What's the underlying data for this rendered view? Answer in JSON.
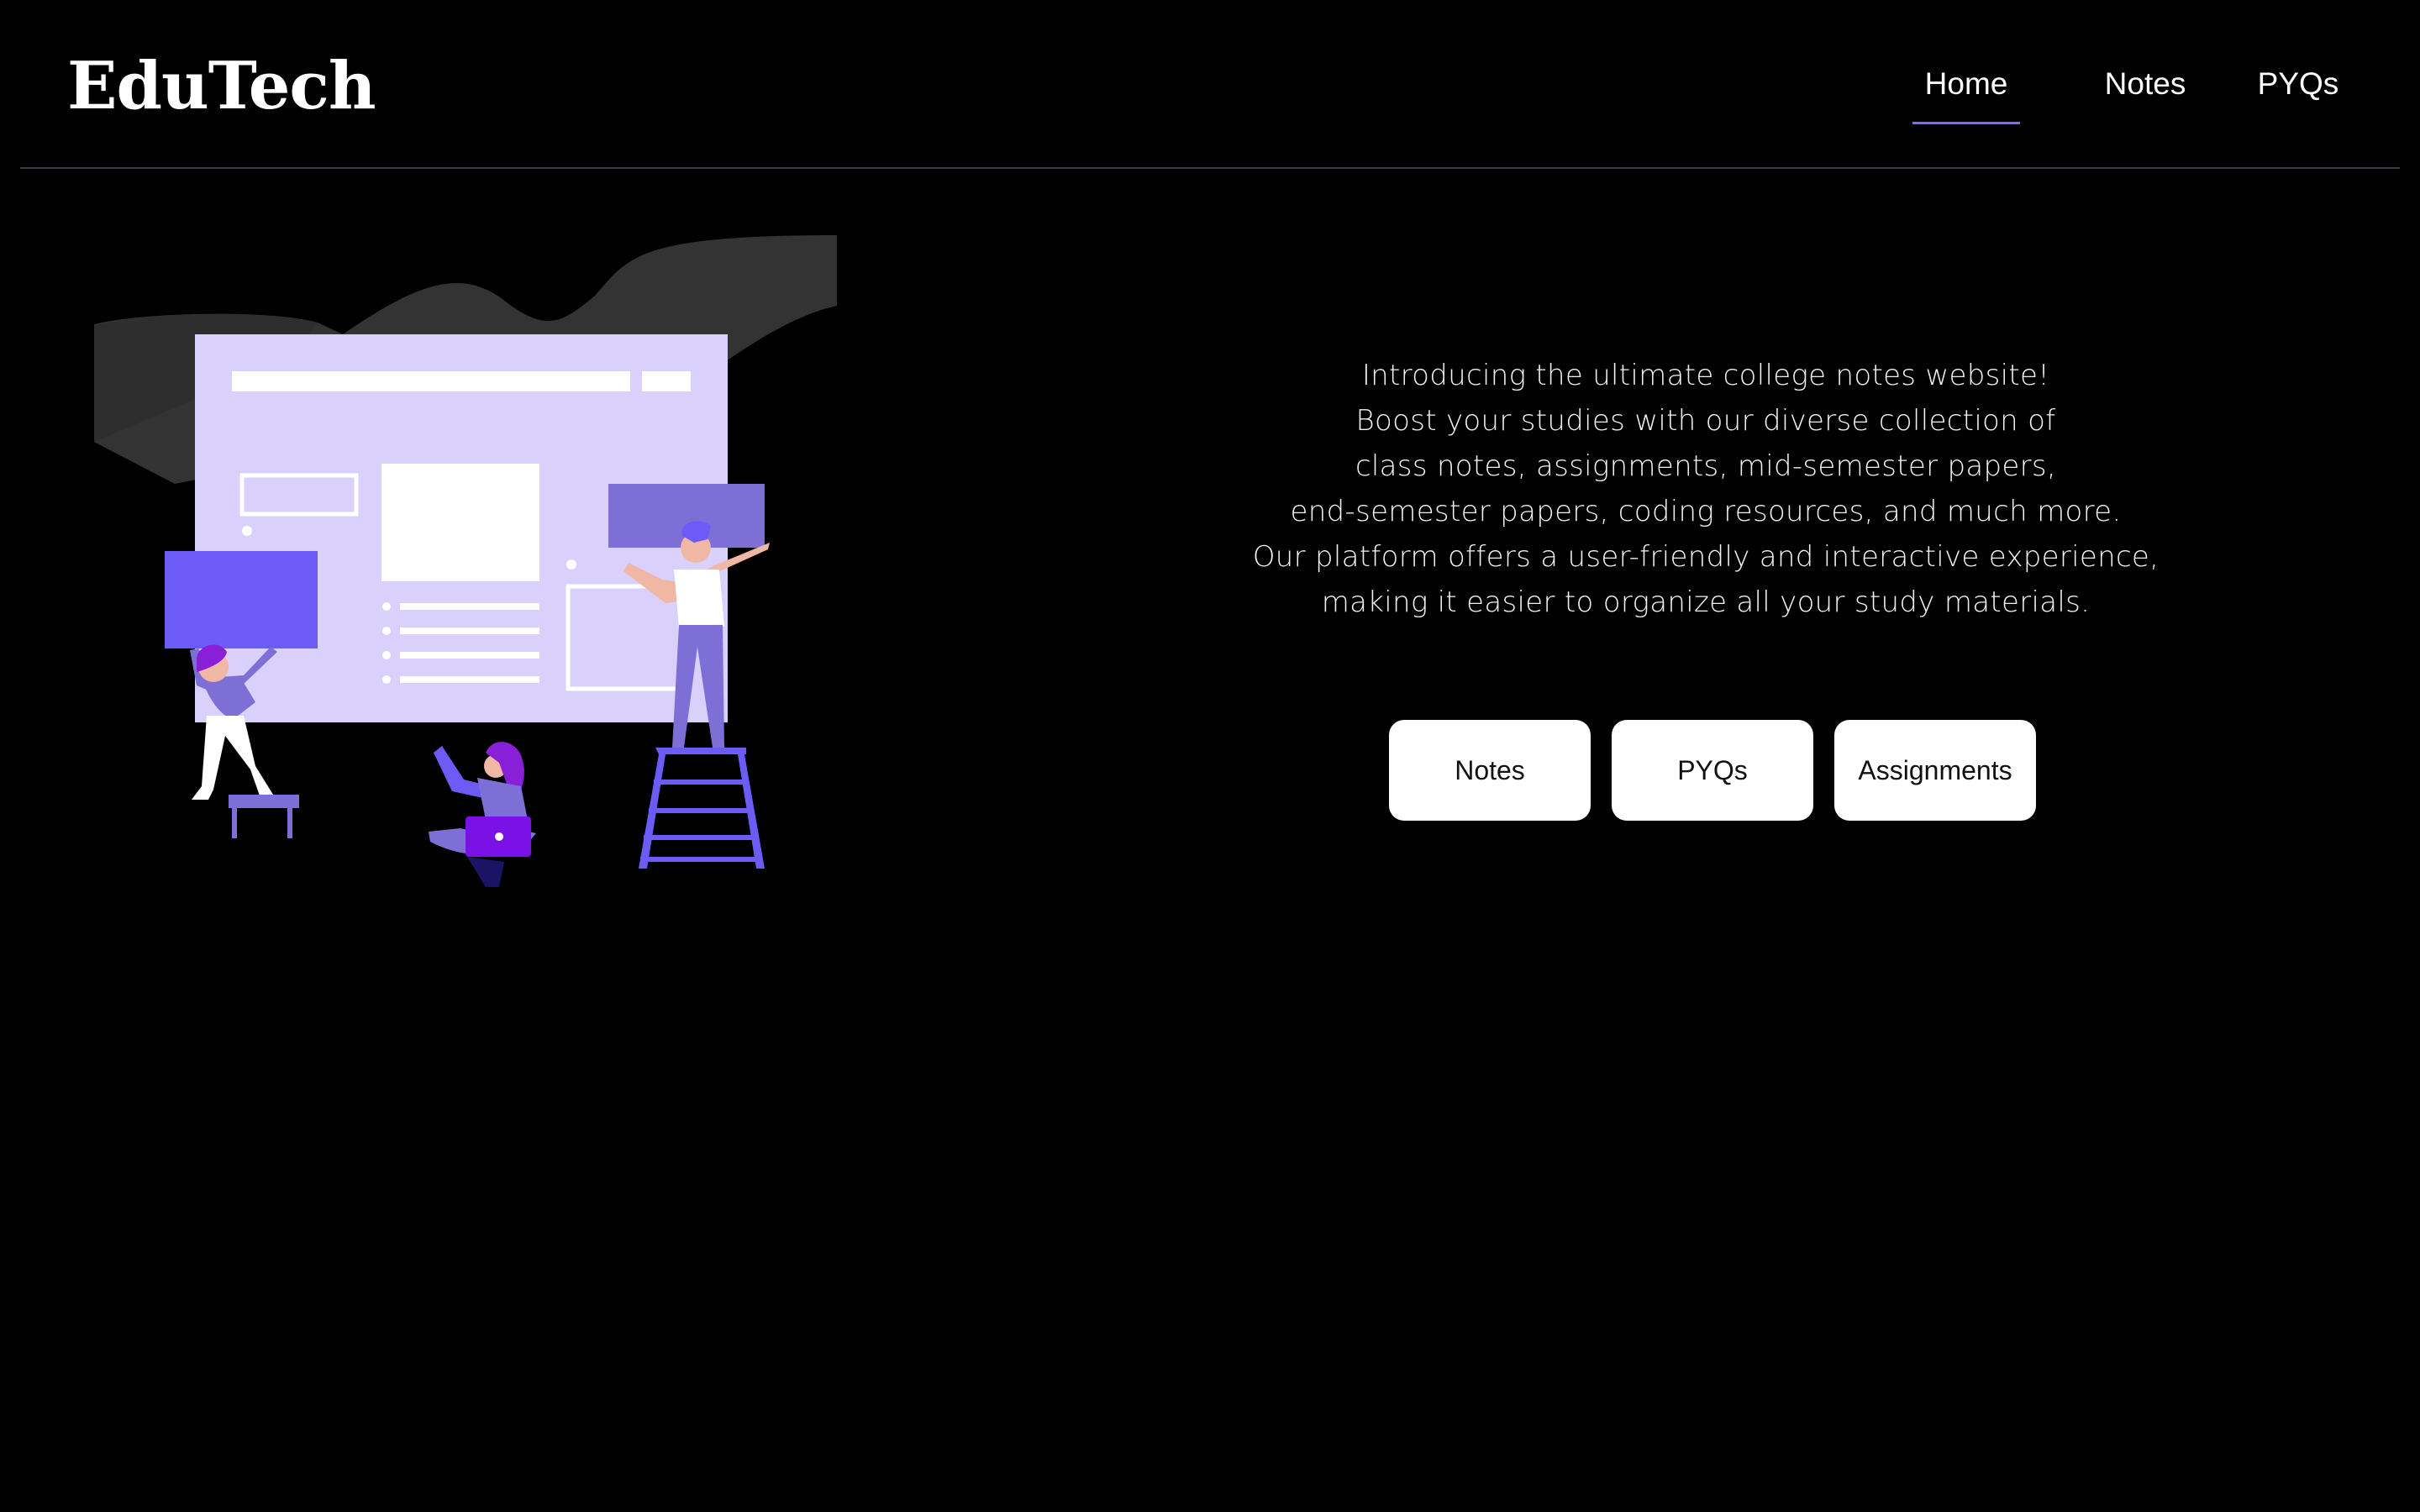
{
  "brand": {
    "name": "EduTech"
  },
  "nav": {
    "items": [
      {
        "label": "Home",
        "active": true
      },
      {
        "label": "Notes",
        "active": false
      },
      {
        "label": "PYQs",
        "active": false
      }
    ]
  },
  "hero": {
    "intro_lines": [
      "Introducing the ultimate college notes website!",
      "Boost your studies with our diverse collection of",
      "class notes, assignments, mid-semester papers,",
      "end-semester papers, coding resources, and much more.",
      "Our platform offers a user-friendly and interactive experience,",
      "making it easier to organize all your study materials."
    ],
    "buttons": [
      {
        "label": "Notes"
      },
      {
        "label": "PYQs"
      },
      {
        "label": "Assignments"
      }
    ],
    "illustration_icon": "team-building-website-illustration"
  },
  "colors": {
    "background": "#000000",
    "accent": "#7b6cf6",
    "illustration_panel": "#d9d0fb",
    "illustration_purple": "#6c5cf5",
    "button_bg": "#ffffff"
  }
}
